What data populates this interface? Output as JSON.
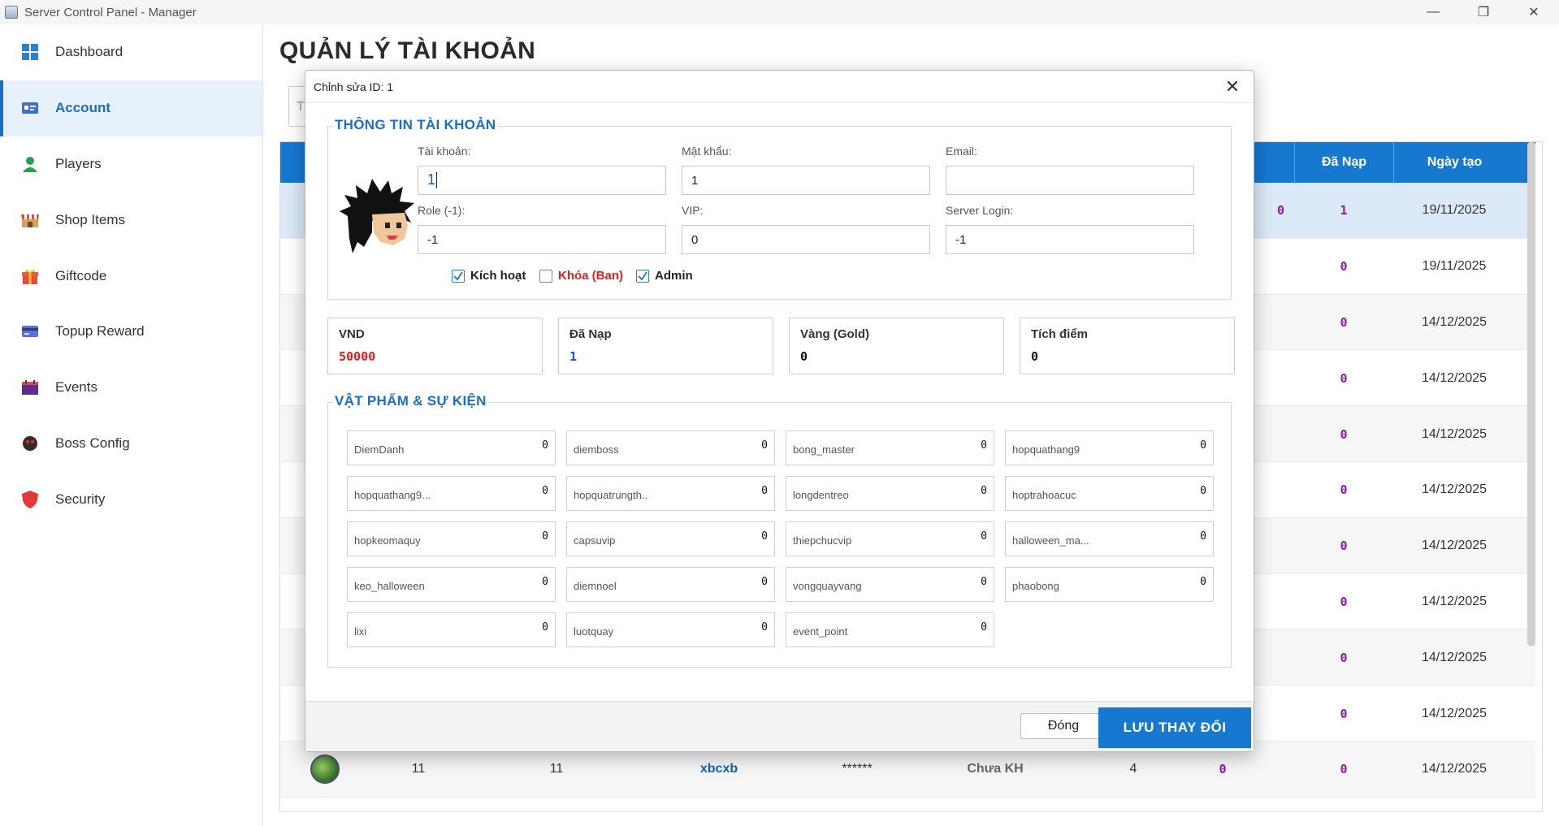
{
  "window": {
    "title": "Server Control Panel - Manager"
  },
  "sidebar": {
    "items": [
      {
        "label": "Dashboard",
        "icon": "dashboard-icon"
      },
      {
        "label": "Account",
        "icon": "account-card-icon"
      },
      {
        "label": "Players",
        "icon": "player-icon"
      },
      {
        "label": "Shop Items",
        "icon": "shop-icon"
      },
      {
        "label": "Giftcode",
        "icon": "gift-icon"
      },
      {
        "label": "Topup Reward",
        "icon": "card-icon"
      },
      {
        "label": "Events",
        "icon": "events-icon"
      },
      {
        "label": "Boss Config",
        "icon": "boss-icon"
      },
      {
        "label": "Security",
        "icon": "shield-icon"
      }
    ]
  },
  "main": {
    "title": "QUẢN LÝ TÀI KHOẢN",
    "search_hint": "T",
    "columns": {
      "da_nap": "Đã Nạp",
      "ngay_tao": "Ngày tạo"
    },
    "rows": [
      {
        "mid": "0",
        "da_nap": "1",
        "date": "19/11/2025"
      },
      {
        "mid": "",
        "da_nap": "0",
        "date": "19/11/2025"
      },
      {
        "mid": "",
        "da_nap": "0",
        "date": "14/12/2025"
      },
      {
        "mid": "",
        "da_nap": "0",
        "date": "14/12/2025"
      },
      {
        "mid": "",
        "da_nap": "0",
        "date": "14/12/2025"
      },
      {
        "mid": "",
        "da_nap": "0",
        "date": "14/12/2025"
      },
      {
        "mid": "",
        "da_nap": "0",
        "date": "14/12/2025"
      },
      {
        "mid": "",
        "da_nap": "0",
        "date": "14/12/2025"
      },
      {
        "mid": "",
        "da_nap": "0",
        "date": "14/12/2025"
      },
      {
        "mid": "",
        "da_nap": "0",
        "date": "14/12/2025"
      }
    ],
    "last_row": {
      "id": "11",
      "id2": "11",
      "username": "xbcxb",
      "password": "******",
      "status": "Chưa KH",
      "role": "4",
      "vip": "0",
      "da_nap": "0",
      "date": "14/12/2025"
    }
  },
  "dialog": {
    "title": "Chỉnh sửa ID: 1",
    "account_section": "THÔNG TIN TÀI KHOẢN",
    "fields": {
      "username": {
        "label": "Tài khoản:",
        "value": "1"
      },
      "password": {
        "label": "Mật khẩu:",
        "value": "1"
      },
      "email": {
        "label": "Email:",
        "value": ""
      },
      "role": {
        "label": "Role (-1):",
        "value": "-1"
      },
      "vip": {
        "label": "VIP:",
        "value": "0"
      },
      "server_login": {
        "label": "Server Login:",
        "value": "-1"
      }
    },
    "checkboxes": {
      "active": {
        "label": "Kích hoạt",
        "checked": true
      },
      "ban": {
        "label": "Khóa (Ban)",
        "checked": false
      },
      "admin": {
        "label": "Admin",
        "checked": true
      }
    },
    "stats": [
      {
        "label": "VND",
        "value": "50000",
        "color": "#e02020"
      },
      {
        "label": "Đã Nạp",
        "value": "1",
        "color": "#1a4fd0"
      },
      {
        "label": "Vàng (Gold)",
        "value": "0",
        "color": "#111111"
      },
      {
        "label": "Tích điểm",
        "value": "0",
        "color": "#111111"
      }
    ],
    "items_section": "VẬT PHẨM & SỰ KIỆN",
    "items": [
      {
        "name": "DiemDanh",
        "qty": "0"
      },
      {
        "name": "diemboss",
        "qty": "0"
      },
      {
        "name": "bong_master",
        "qty": "0"
      },
      {
        "name": "hopquathang9",
        "qty": "0"
      },
      {
        "name": "hopquathang9...",
        "qty": "0"
      },
      {
        "name": "hopquatrungth..",
        "qty": "0"
      },
      {
        "name": "longdentreo",
        "qty": "0"
      },
      {
        "name": "hoptrahoacuc",
        "qty": "0"
      },
      {
        "name": "hopkeomaquy",
        "qty": "0"
      },
      {
        "name": "capsuvip",
        "qty": "0"
      },
      {
        "name": "thiepchucvip",
        "qty": "0"
      },
      {
        "name": "halloween_ma...",
        "qty": "0"
      },
      {
        "name": "keo_halloween",
        "qty": "0"
      },
      {
        "name": "diemnoel",
        "qty": "0"
      },
      {
        "name": "vongquayvang",
        "qty": "0"
      },
      {
        "name": "phaobong",
        "qty": "0"
      },
      {
        "name": "lixi",
        "qty": "0"
      },
      {
        "name": "luotquay",
        "qty": "0"
      },
      {
        "name": "event_point",
        "qty": "0"
      }
    ],
    "buttons": {
      "close": "Đóng",
      "save": "LƯU THAY ĐỔI"
    }
  },
  "colors": {
    "accent": "#1778d0",
    "danger": "#e02020",
    "purple": "#8a1aa8"
  }
}
